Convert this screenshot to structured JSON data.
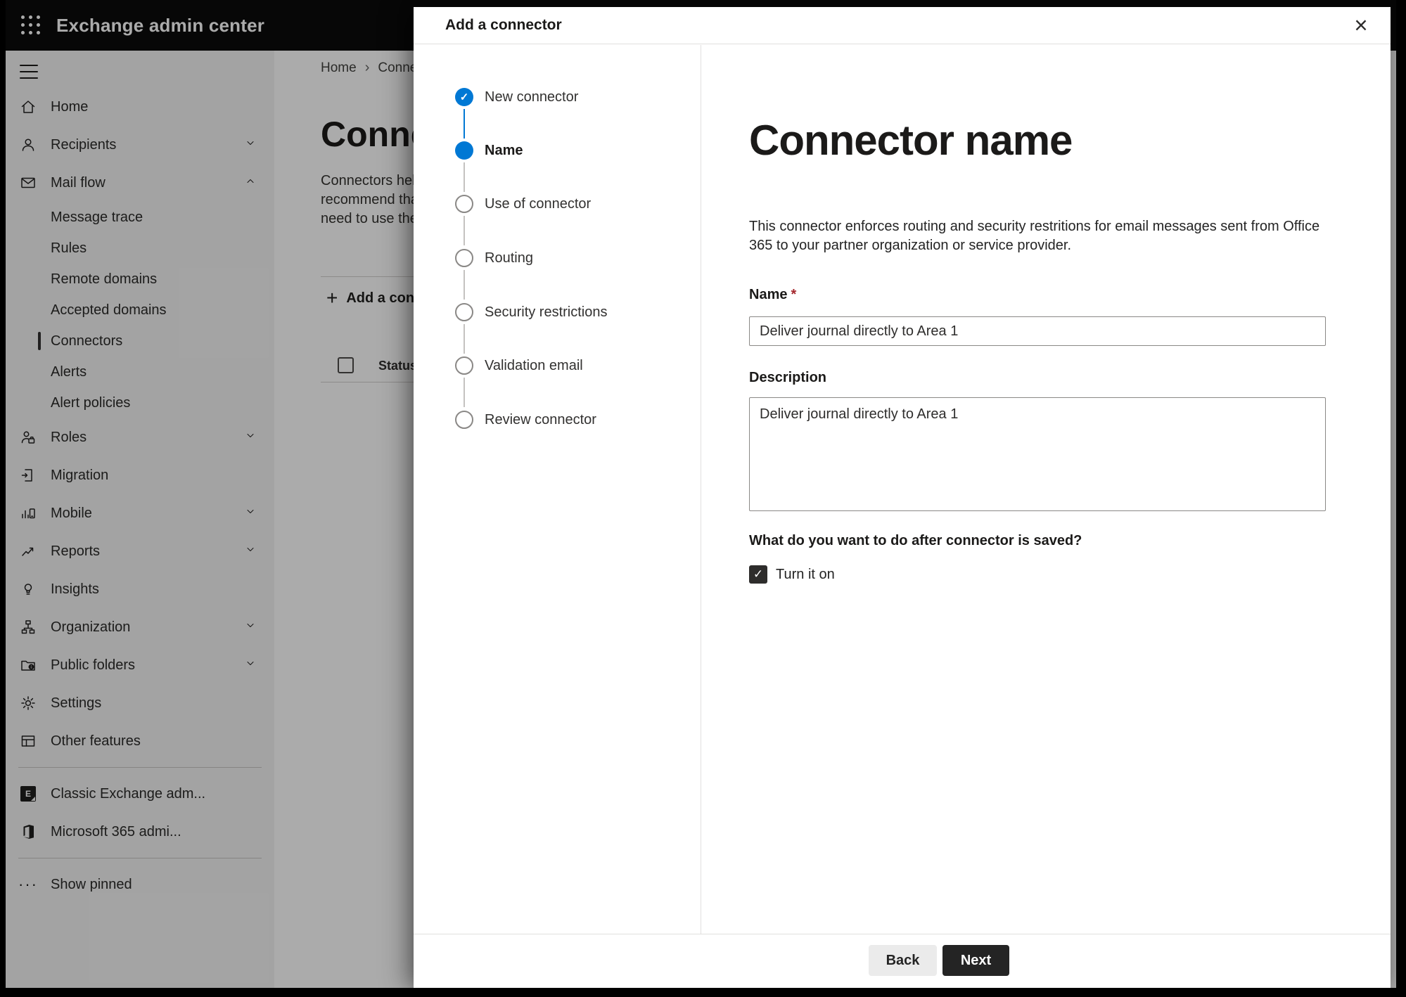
{
  "topbar": {
    "app_title": "Exchange admin center"
  },
  "sidebar": {
    "items": [
      {
        "label": "Home",
        "icon": "home-icon"
      },
      {
        "label": "Recipients",
        "icon": "person-icon",
        "chevron": "down"
      },
      {
        "label": "Mail flow",
        "icon": "mail-icon",
        "chevron": "up",
        "expanded": true
      },
      {
        "label": "Message trace"
      },
      {
        "label": "Rules"
      },
      {
        "label": "Remote domains"
      },
      {
        "label": "Accepted domains"
      },
      {
        "label": "Connectors",
        "selected": true
      },
      {
        "label": "Alerts"
      },
      {
        "label": "Alert policies"
      },
      {
        "label": "Roles",
        "icon": "roles-icon",
        "chevron": "down"
      },
      {
        "label": "Migration",
        "icon": "migration-icon"
      },
      {
        "label": "Mobile",
        "icon": "mobile-icon",
        "chevron": "down"
      },
      {
        "label": "Reports",
        "icon": "reports-icon",
        "chevron": "down"
      },
      {
        "label": "Insights",
        "icon": "insights-icon"
      },
      {
        "label": "Organization",
        "icon": "organization-icon",
        "chevron": "down"
      },
      {
        "label": "Public folders",
        "icon": "public-folders-icon",
        "chevron": "down"
      },
      {
        "label": "Settings",
        "icon": "settings-icon"
      },
      {
        "label": "Other features",
        "icon": "other-features-icon"
      },
      {
        "label": "Classic Exchange adm...",
        "icon": "classic-exchange-icon"
      },
      {
        "label": "Microsoft 365 admi...",
        "icon": "microsoft-365-icon"
      },
      {
        "label": "Show pinned",
        "icon": "more-icon"
      }
    ],
    "exchange_badge_letter": "E"
  },
  "page": {
    "breadcrumb": {
      "home": "Home",
      "separator": "›",
      "current": "Conne"
    },
    "title": "Connec",
    "description_lines": [
      "Connectors help",
      "recommend tha",
      "need to use ther"
    ],
    "add_button_label": "Add a conn",
    "add_button_plus": "+",
    "table": {
      "status_header": "Status"
    }
  },
  "modal": {
    "title": "Add a connector",
    "close_glyph": "×",
    "steps": [
      {
        "label": "New connector",
        "state": "completed",
        "glyph": "✓"
      },
      {
        "label": "Name",
        "state": "current"
      },
      {
        "label": "Use of connector",
        "state": "upcoming"
      },
      {
        "label": "Routing",
        "state": "upcoming"
      },
      {
        "label": "Security restrictions",
        "state": "upcoming"
      },
      {
        "label": "Validation email",
        "state": "upcoming"
      },
      {
        "label": "Review connector",
        "state": "upcoming"
      }
    ],
    "content": {
      "heading": "Connector name",
      "description": "This connector enforces routing and security restritions for email messages sent from Office 365 to your partner organization or service provider.",
      "name_label": "Name",
      "required_marker": "*",
      "name_value": "Deliver journal directly to Area 1",
      "description_label": "Description",
      "description_value": "Deliver journal directly to Area 1",
      "after_save_question": "What do you want to do after connector is saved?",
      "turn_on_label": "Turn it on",
      "checkmark": "✓"
    },
    "footer": {
      "back_label": "Back",
      "next_label": "Next"
    }
  },
  "colors": {
    "accent": "#0078d4",
    "required": "#a4262c",
    "primary_button": "#242424",
    "topbar": "#0b0b0b"
  }
}
